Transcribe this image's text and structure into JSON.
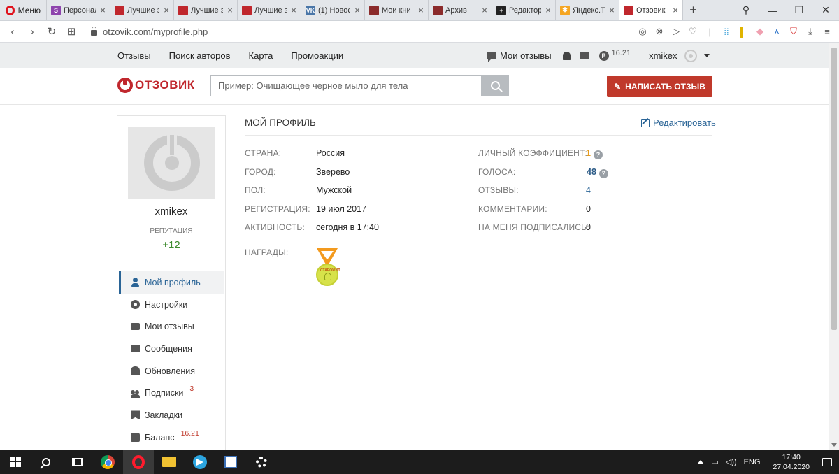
{
  "browser": {
    "menu_label": "Меню",
    "tabs": [
      {
        "label": "Персонал",
        "color": "#8e44ad",
        "glyph": "S"
      },
      {
        "label": "Лучшие з",
        "color": "#c0272d",
        "glyph": ""
      },
      {
        "label": "Лучшие з",
        "color": "#c0272d",
        "glyph": ""
      },
      {
        "label": "Лучшие з",
        "color": "#c0272d",
        "glyph": ""
      },
      {
        "label": "(1) Новос",
        "color": "#4a76a8",
        "glyph": "VK"
      },
      {
        "label": "Мои кни",
        "color": "#8b2b2b",
        "glyph": ""
      },
      {
        "label": "Архив",
        "color": "#8b2b2b",
        "glyph": ""
      },
      {
        "label": "Редактор",
        "color": "#222222",
        "glyph": "+"
      },
      {
        "label": "Яндекс.Т",
        "color": "#f5a623",
        "glyph": "✱"
      },
      {
        "label": "Отзовик",
        "color": "#c0272d",
        "glyph": "",
        "active": true
      }
    ],
    "url": "otzovik.com/myprofile.php"
  },
  "sitenav": {
    "links": [
      "Отзывы",
      "Поиск авторов",
      "Карта",
      "Промоакции"
    ],
    "my_reviews": "Мои отзывы",
    "coin_symbol": "Р",
    "balance": "16.21",
    "username": "xmikex"
  },
  "header": {
    "logo_text": "ОТЗОВИК",
    "search_placeholder": "Пример: Очищающее черное мыло для тела",
    "write_button": "НАПИСАТЬ ОТЗЫВ"
  },
  "sidebar": {
    "name": "xmikex",
    "reputation_label": "РЕПУТАЦИЯ",
    "reputation_value": "+12",
    "menu": [
      {
        "label": "Мой профиль",
        "icon": "user-icon",
        "active": true
      },
      {
        "label": "Настройки",
        "icon": "gear-icon"
      },
      {
        "label": "Мои отзывы",
        "icon": "chat-icon"
      },
      {
        "label": "Сообщения",
        "icon": "mail-icon"
      },
      {
        "label": "Обновления",
        "icon": "bell-icon"
      },
      {
        "label": "Подписки",
        "icon": "users-icon",
        "sup": "3"
      },
      {
        "label": "Закладки",
        "icon": "bookmark-icon"
      },
      {
        "label": "Баланс",
        "icon": "bag-icon",
        "sup": "16.21"
      }
    ]
  },
  "profile": {
    "title": "МОЙ ПРОФИЛЬ",
    "edit_label": "Редактировать",
    "left": [
      {
        "label": "СТРАНА:",
        "value": "Россия"
      },
      {
        "label": "ГОРОД:",
        "value": "Зверево"
      },
      {
        "label": "ПОЛ:",
        "value": "Мужской"
      },
      {
        "label": "РЕГИСТРАЦИЯ:",
        "value": "19 июл 2017"
      },
      {
        "label": "АКТИВНОСТЬ:",
        "value": "сегодня в 17:40"
      }
    ],
    "right": [
      {
        "label": "ЛИЧНЫЙ КОЭФФИЦИЕНТ:",
        "value": "1",
        "help": "?"
      },
      {
        "label": "ГОЛОСА:",
        "value": "48",
        "help": "?"
      },
      {
        "label": "ОТЗЫВЫ:",
        "value": "4"
      },
      {
        "label": "КОММЕНТАРИИ:",
        "value": "0"
      },
      {
        "label": "НА МЕНЯ ПОДПИСАЛИСЬ:",
        "value": "0"
      }
    ],
    "awards_label": "НАГРАДЫ:",
    "award_text": "СТАРОЖИЛ"
  },
  "taskbar": {
    "lang": "ENG",
    "time": "17:40",
    "date": "27.04.2020"
  }
}
